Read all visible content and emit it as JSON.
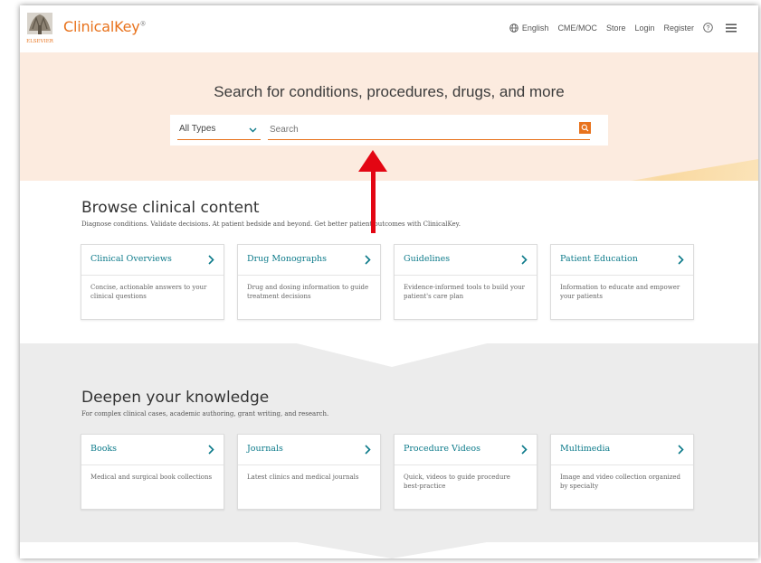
{
  "header": {
    "logo_text": "ClinicalKey",
    "logo_superscript": "®",
    "publisher": "ELSEVIER",
    "nav": {
      "language": "English",
      "cme": "CME/MOC",
      "store": "Store",
      "login": "Login",
      "register": "Register"
    }
  },
  "hero": {
    "title": "Search for conditions, procedures, drugs, and more",
    "type_selected": "All Types",
    "search_placeholder": "Search"
  },
  "browse": {
    "title": "Browse clinical content",
    "subtitle": "Diagnose conditions. Validate decisions. At patient bedside and beyond. Get better patient outcomes with ClinicalKey.",
    "cards": [
      {
        "title": "Clinical Overviews",
        "desc": "Concise, actionable answers to your clinical questions"
      },
      {
        "title": "Drug Monographs",
        "desc": "Drug and dosing information to guide treatment decisions"
      },
      {
        "title": "Guidelines",
        "desc": "Evidence-informed tools to build your patient's care plan"
      },
      {
        "title": "Patient Education",
        "desc": "Information to educate and empower your patients"
      }
    ]
  },
  "deepen": {
    "title": "Deepen your knowledge",
    "subtitle": "For complex clinical cases, academic authoring, grant writing, and research.",
    "cards": [
      {
        "title": "Books",
        "desc": "Medical and surgical book collections"
      },
      {
        "title": "Journals",
        "desc": "Latest clinics and medical journals"
      },
      {
        "title": "Procedure Videos",
        "desc": "Quick, videos to guide procedure best-practice"
      },
      {
        "title": "Multimedia",
        "desc": "Image and video collection organized by specialty"
      }
    ]
  },
  "colors": {
    "brand_orange": "#e8721c",
    "link_teal": "#0c7a8a",
    "hero_bg": "#fcebdf",
    "arrow_red": "#e30613"
  },
  "icons": [
    "globe-icon",
    "help-icon",
    "menu-icon",
    "search-icon",
    "chevron-down-icon",
    "chevron-right-icon"
  ]
}
